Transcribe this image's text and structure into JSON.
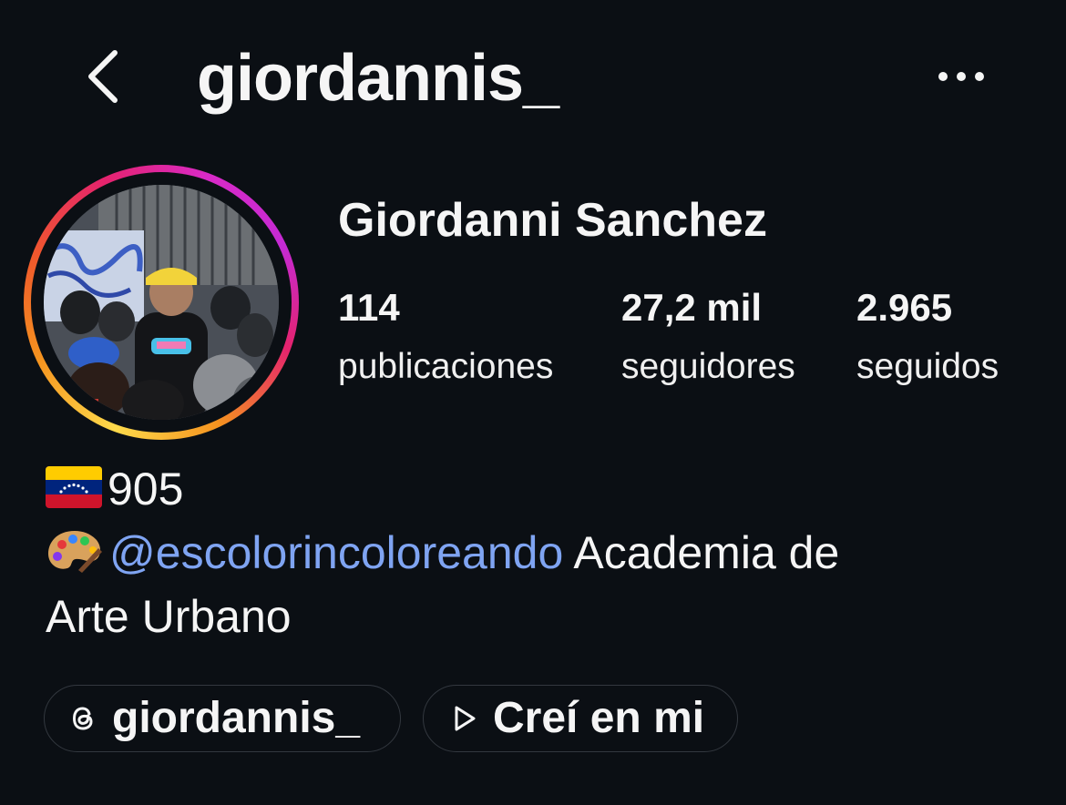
{
  "header": {
    "username": "giordannis_",
    "back_icon": "chevron-left-icon",
    "more_icon": "ellipsis-icon"
  },
  "profile": {
    "full_name": "Giordanni Sanchez",
    "avatar_story_ring": true,
    "stats": {
      "posts": {
        "value": "114",
        "label": "publicaciones"
      },
      "followers": {
        "value": "27,2 mil",
        "label": "seguidores"
      },
      "following": {
        "value": "2.965",
        "label": "seguidos"
      }
    }
  },
  "bio": {
    "line1_emoji": "🇻🇪",
    "line1_text": "905",
    "line2_emoji": "🎨",
    "mention": "@escolorincoloreando",
    "line2_text": " Academia de",
    "line3_text": "Arte Urbano"
  },
  "chips": {
    "threads": {
      "icon": "threads-icon",
      "label": "giordannis_"
    },
    "music": {
      "icon": "play-icon",
      "label": "Creí en mi"
    }
  },
  "colors": {
    "background": "#0b0f14",
    "text": "#f5f5f5",
    "mention": "#7fa4f2",
    "chip_border": "#33383f"
  }
}
